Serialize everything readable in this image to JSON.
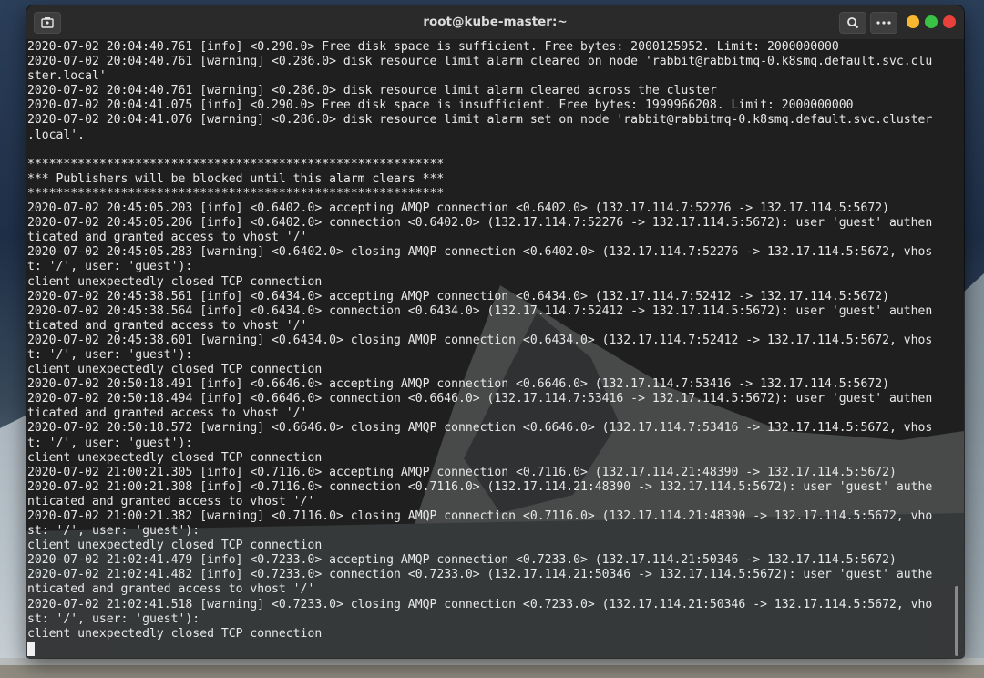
{
  "window": {
    "title": "root@kube-master:~"
  },
  "titlebar": {
    "new_tab_icon": "new-tab-icon",
    "search_icon": "search-icon",
    "menu_icon": "more-icon"
  },
  "colors": {
    "minimize": "#f5b82e",
    "maximize": "#39c246",
    "close": "#e8413c",
    "terminal_bg": "#1e1e1e",
    "text": "#e8e8e8"
  },
  "terminal": {
    "lines": [
      "2020-07-02 20:04:40.761 [info] <0.290.0> Free disk space is sufficient. Free bytes: 2000125952. Limit: 2000000000",
      "2020-07-02 20:04:40.761 [warning] <0.286.0> disk resource limit alarm cleared on node 'rabbit@rabbitmq-0.k8smq.default.svc.clu",
      "ster.local'",
      "2020-07-02 20:04:40.761 [warning] <0.286.0> disk resource limit alarm cleared across the cluster",
      "2020-07-02 20:04:41.075 [info] <0.290.0> Free disk space is insufficient. Free bytes: 1999966208. Limit: 2000000000",
      "2020-07-02 20:04:41.076 [warning] <0.286.0> disk resource limit alarm set on node 'rabbit@rabbitmq-0.k8smq.default.svc.cluster",
      ".local'.",
      "",
      "**********************************************************",
      "*** Publishers will be blocked until this alarm clears ***",
      "**********************************************************",
      "2020-07-02 20:45:05.203 [info] <0.6402.0> accepting AMQP connection <0.6402.0> (132.17.114.7:52276 -> 132.17.114.5:5672)",
      "2020-07-02 20:45:05.206 [info] <0.6402.0> connection <0.6402.0> (132.17.114.7:52276 -> 132.17.114.5:5672): user 'guest' authen",
      "ticated and granted access to vhost '/'",
      "2020-07-02 20:45:05.283 [warning] <0.6402.0> closing AMQP connection <0.6402.0> (132.17.114.7:52276 -> 132.17.114.5:5672, vhos",
      "t: '/', user: 'guest'):",
      "client unexpectedly closed TCP connection",
      "2020-07-02 20:45:38.561 [info] <0.6434.0> accepting AMQP connection <0.6434.0> (132.17.114.7:52412 -> 132.17.114.5:5672)",
      "2020-07-02 20:45:38.564 [info] <0.6434.0> connection <0.6434.0> (132.17.114.7:52412 -> 132.17.114.5:5672): user 'guest' authen",
      "ticated and granted access to vhost '/'",
      "2020-07-02 20:45:38.601 [warning] <0.6434.0> closing AMQP connection <0.6434.0> (132.17.114.7:52412 -> 132.17.114.5:5672, vhos",
      "t: '/', user: 'guest'):",
      "client unexpectedly closed TCP connection",
      "2020-07-02 20:50:18.491 [info] <0.6646.0> accepting AMQP connection <0.6646.0> (132.17.114.7:53416 -> 132.17.114.5:5672)",
      "2020-07-02 20:50:18.494 [info] <0.6646.0> connection <0.6646.0> (132.17.114.7:53416 -> 132.17.114.5:5672): user 'guest' authen",
      "ticated and granted access to vhost '/'",
      "2020-07-02 20:50:18.572 [warning] <0.6646.0> closing AMQP connection <0.6646.0> (132.17.114.7:53416 -> 132.17.114.5:5672, vhos",
      "t: '/', user: 'guest'):",
      "client unexpectedly closed TCP connection",
      "2020-07-02 21:00:21.305 [info] <0.7116.0> accepting AMQP connection <0.7116.0> (132.17.114.21:48390 -> 132.17.114.5:5672)",
      "2020-07-02 21:00:21.308 [info] <0.7116.0> connection <0.7116.0> (132.17.114.21:48390 -> 132.17.114.5:5672): user 'guest' authe",
      "nticated and granted access to vhost '/'",
      "2020-07-02 21:00:21.382 [warning] <0.7116.0> closing AMQP connection <0.7116.0> (132.17.114.21:48390 -> 132.17.114.5:5672, vho",
      "st: '/', user: 'guest'):",
      "client unexpectedly closed TCP connection",
      "2020-07-02 21:02:41.479 [info] <0.7233.0> accepting AMQP connection <0.7233.0> (132.17.114.21:50346 -> 132.17.114.5:5672)",
      "2020-07-02 21:02:41.482 [info] <0.7233.0> connection <0.7233.0> (132.17.114.21:50346 -> 132.17.114.5:5672): user 'guest' authe",
      "nticated and granted access to vhost '/'",
      "2020-07-02 21:02:41.518 [warning] <0.7233.0> closing AMQP connection <0.7233.0> (132.17.114.21:50346 -> 132.17.114.5:5672, vho",
      "st: '/', user: 'guest'):",
      "client unexpectedly closed TCP connection"
    ]
  }
}
